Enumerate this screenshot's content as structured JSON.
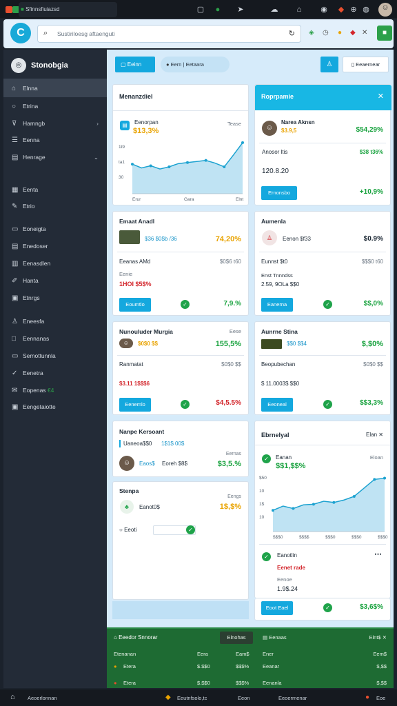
{
  "topbar": {
    "tab_title": "Sfinnsfiuiazsd",
    "colors": {
      "dot1": "#e94f2e",
      "dot2": "#2ca04a"
    },
    "icons": [
      "terminal-icon",
      "record-icon",
      "send-icon",
      "cloud-icon",
      "home-icon",
      "alert-icon",
      "notification-icon",
      "more-icon",
      "avatar"
    ]
  },
  "address": {
    "search_placeholder": "Sustiriloesg aftaenguti",
    "ext_icons": [
      "green-leaf-icon",
      "clock-icon",
      "circle-icon",
      "record-icon",
      "tools-icon",
      "green-square-icon"
    ]
  },
  "sidebar": {
    "brand": "Stonobgia",
    "items": [
      {
        "label": "Elnna",
        "icon": "home-icon",
        "active": true
      },
      {
        "label": "Etrina",
        "icon": "circle-icon"
      },
      {
        "label": "Hamngb",
        "icon": "funnel-icon",
        "chevron": true
      },
      {
        "label": "Eenna",
        "icon": "list-icon"
      },
      {
        "label": "Henrage",
        "icon": "tag-icon",
        "chevron": true
      },
      {
        "label": "Eenta",
        "icon": "stack-icon"
      },
      {
        "label": "Etrio",
        "icon": "pen-icon"
      },
      {
        "label": "Eoneigta",
        "icon": "card-icon"
      },
      {
        "label": "Enedoser",
        "icon": "doc-icon"
      },
      {
        "label": "Eenasdlen",
        "icon": "chart-icon"
      },
      {
        "label": "Hanta",
        "icon": "edit-icon"
      },
      {
        "label": "Etnrgs",
        "icon": "book-icon"
      },
      {
        "label": "Eneesfa",
        "icon": "user-icon"
      },
      {
        "label": "Eennanas",
        "icon": "square-icon"
      },
      {
        "label": "Semottunnla",
        "icon": "monitor-icon"
      },
      {
        "label": "Eenetra",
        "icon": "check-circle-icon"
      },
      {
        "label": "Eopenas",
        "icon": "mail-icon",
        "badge": "€4"
      },
      {
        "label": "Eengetaiotte",
        "icon": "save-icon"
      }
    ]
  },
  "toolbar": {
    "btn1": "Eeinn",
    "btn2_a": "Eern",
    "btn2_b": "Eetaara",
    "btn_right": "Eeaernear"
  },
  "card_chart1": {
    "title": "Menanzdiel",
    "label": "Eenorpan",
    "value": "$13,3%",
    "corner": "Tease"
  },
  "chart1_data": {
    "type": "line",
    "y_ticks": [
      "1t9",
      "ta1",
      "30"
    ],
    "x_ticks": [
      "Erur",
      "Gara",
      "Elnt"
    ],
    "values": [
      55,
      48,
      52,
      46,
      50,
      56,
      58,
      60,
      62,
      57,
      50,
      72,
      95
    ]
  },
  "card_agent": {
    "title": "Roprpamie",
    "name": "Narea Aknsn",
    "sub": "$3.9,5",
    "pct1": "$54,29%",
    "row_label": "Anosor ltis",
    "row_pct": "$38 t36%",
    "num": "120.8.20",
    "button": "Ernonsbo",
    "pct2": "+10,9%"
  },
  "card_a": {
    "title": "Emaat Anadl",
    "sub": "$36 $0$b /36",
    "pct": "74,20%",
    "row_label": "Eeanas AMd",
    "row_val": "$0$6 t60",
    "sub2": "Eenie",
    "num": "1HOI $5$%",
    "button": "Eoumtlo",
    "pct2": "7,9.%"
  },
  "card_b": {
    "title": "Aumenla",
    "sub": "Eenon $f33",
    "pct": "$0.9%",
    "row_label": "Eunnst $t0",
    "row_val": "$$$0 t60",
    "line2": "Enst Tnnndss",
    "num": "2.59, 9OLa $$0",
    "button": "Eanerna",
    "pct2": "$$,0%"
  },
  "card_c": {
    "title": "Nunouluder Murgia",
    "sub": "$0$0 $$",
    "corner": "Eese",
    "pct": "155,5%",
    "row_label": "Ranmatat",
    "row_val": "$0$0 $$",
    "num": "$3.11 1$$$6",
    "button": "Eenemlo",
    "pct2": "$4,5.5%"
  },
  "card_d": {
    "title": "Aunrne Stina",
    "sub": "$$0 $$4",
    "pct": "$,$0%",
    "row_label": "Beopubechan",
    "row_val": "$0$0 $$",
    "num": "$ 11.0003$ $$0",
    "button": "Eeoneal",
    "pct2": "$$3,3%"
  },
  "card_e": {
    "title": "Nanpe Kersoant",
    "sub1": "Uaneoa$$0",
    "sub1b": "1$1$ 00$",
    "name": "Eaos$",
    "value": "Eoreh $8$",
    "pct_label": "Eernas",
    "pct": "$3,5.%"
  },
  "card_f": {
    "title": "Stenpa",
    "corner": "Eengs",
    "sub": "Eanot0$",
    "pct": "1$,$%",
    "input": "Eeoti"
  },
  "card_chart2": {
    "title": "Ebrnelyal",
    "close": "Elan",
    "label": "Eanan",
    "value": "$$1,$$%",
    "corner": "Eloan",
    "footer_label": "Eanotlin",
    "footer_sub": "Eenet rade",
    "footer_sub2": "Eenoe",
    "num": "1.9$.24",
    "button": "Eoot Eael",
    "pct": "$3,6$%"
  },
  "chart2_data": {
    "type": "line",
    "y_ticks": [
      "$50",
      "10",
      "1$",
      "10"
    ],
    "x_ticks": [
      "$$$0",
      "$$$$",
      "$$$0",
      "$$$0",
      "$$$0"
    ],
    "values": [
      35,
      42,
      38,
      44,
      45,
      50,
      48,
      52,
      58,
      72,
      86,
      88
    ]
  },
  "greenpanel": {
    "title": "Eeedor Snnorar",
    "tab1": "Elnohas",
    "tab2": "Eenaas",
    "corner": "Elnt$",
    "headers": [
      "Etenanan",
      "Eera",
      "Eam$",
      "Ener",
      "Eem$"
    ],
    "rows": [
      [
        "Etera",
        "$.$$0",
        "$$$%",
        "Eeanar",
        "$,$$"
      ],
      [
        "Etera",
        "$.$$0",
        "$$$%",
        "Eenanla",
        "$,$$"
      ]
    ]
  },
  "bottombar": {
    "label1": "Aeoerlonnan",
    "label2": "Eeutnfsolo,tc",
    "label3": "Eeon",
    "label4": "Eeoermenar",
    "label5": "Eoe"
  }
}
